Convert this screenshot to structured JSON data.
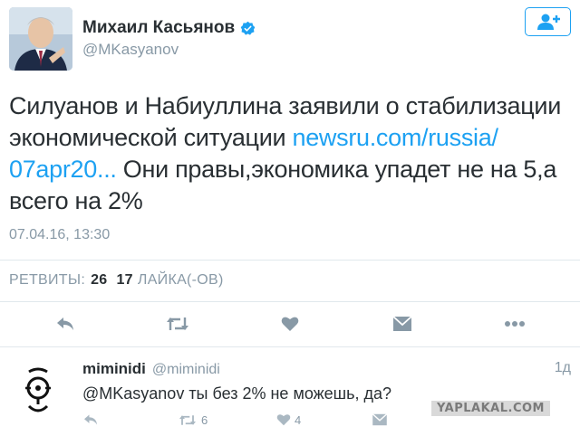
{
  "author": {
    "name": "Михаил Касьянов",
    "handle": "@MKasyanov"
  },
  "tweet": {
    "text_before_link": "Силуанов и Набиуллина заявили о стабилизации экономической ситуации ",
    "link": "newsru.com/russia/ 07apr20...",
    "text_after_link": " Они правы,экономика упадет не на 5,а всего на 2%",
    "timestamp": "07.04.16, 13:30"
  },
  "stats": {
    "retweets_label": "РЕТВИТЫ:",
    "retweets_count": "26",
    "likes_count": "17",
    "likes_label": "ЛАЙКА(-ОВ)"
  },
  "icons": {
    "reply": "reply-icon",
    "retweet": "retweet-icon",
    "like": "heart-icon",
    "dm": "envelope-icon",
    "more": "more-icon",
    "follow": "follow-icon",
    "verified": "verified-icon"
  },
  "reply": {
    "name": "miminidi",
    "handle": "@miminidi",
    "time": "1д",
    "text": "@MKasyanov ты без 2% не можешь, да?",
    "retweet_count": "6",
    "like_count": "4"
  },
  "watermark": "YAPLAKAL.COM",
  "colors": {
    "accent": "#1da1f2",
    "text": "#292f33",
    "muted": "#8899a6",
    "divider": "#e1e8ed"
  }
}
